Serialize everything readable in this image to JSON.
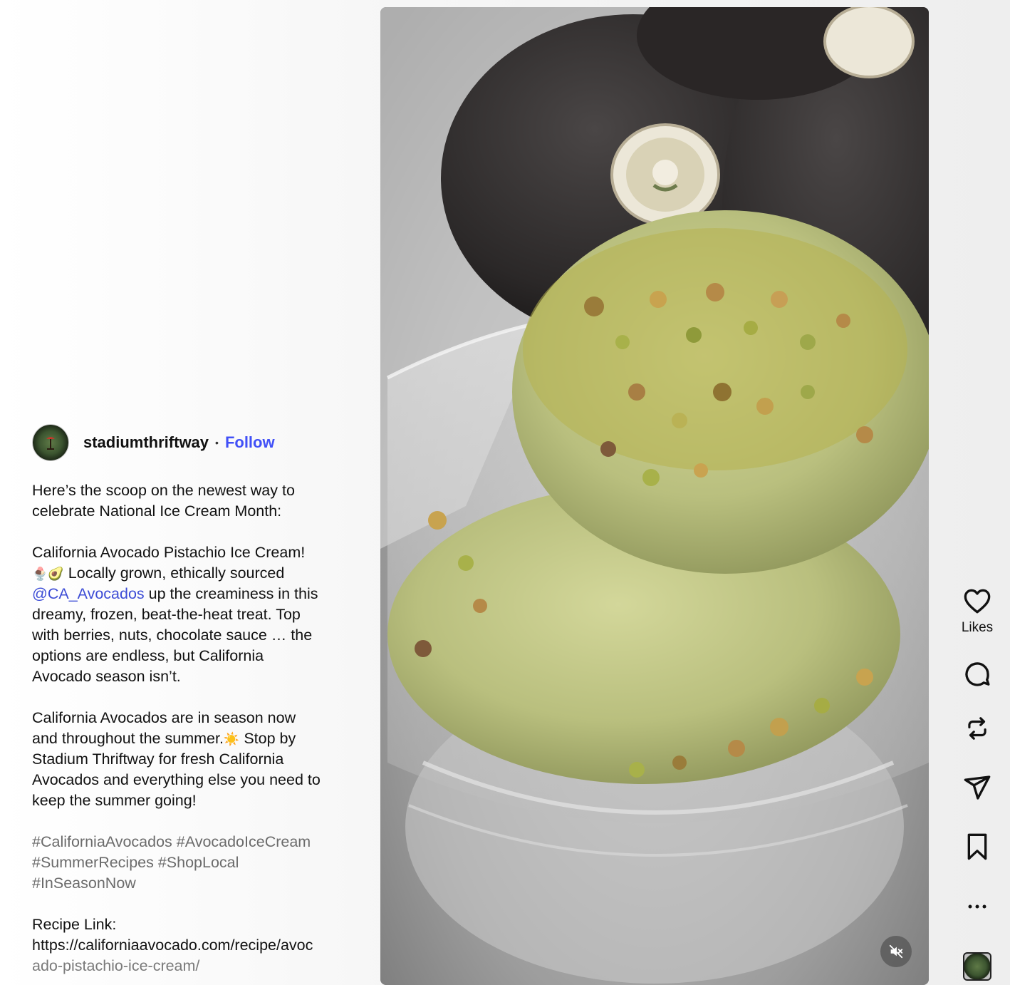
{
  "post": {
    "author": {
      "username": "stadiumthriftway",
      "separator": "•",
      "follow_label": "Follow"
    },
    "caption": {
      "intro_line1": "Here’s the scoop on the newest way to",
      "intro_line2": "celebrate National Ice Cream Month:",
      "p2_line1": "California Avocado Pistachio Ice Cream!",
      "p2_emoji": "🍨🥑",
      "p2_line2_text": " Locally grown, ethically sourced",
      "p2_mention": "@CA_Avocados",
      "p2_line3_text": " up the creaminess in this",
      "p2_line4": "dreamy, frozen, beat-the-heat treat. Top",
      "p2_line5": "with berries, nuts, chocolate sauce … the",
      "p2_line6": "options are endless, but California",
      "p2_line7": "Avocado season isn’t.",
      "p3_line1": "California Avocados are in season now",
      "p3_line2_text": "and throughout the summer.",
      "p3_emoji": "☀️",
      "p3_line2_rest": " Stop by",
      "p3_line3": "Stadium Thriftway for fresh California",
      "p3_line4": "Avocados and everything else you need to",
      "p3_line5": "keep the summer going!",
      "hashtags_line1": "#CaliforniaAvocados #AvocadoIceCream",
      "hashtags_line2": "#SummerRecipes #ShopLocal",
      "hashtags_line3": "#InSeasonNow",
      "recipe_label": "Recipe Link:",
      "recipe_url_line1": "https://californiaavocado.com/recipe/avoc",
      "recipe_url_line2": "ado-pistachio-ice-cream/"
    }
  },
  "actions": {
    "likes_label": "Likes",
    "icons": [
      "heart-icon",
      "comment-icon",
      "repost-icon",
      "share-icon",
      "bookmark-icon",
      "more-icon"
    ]
  },
  "media": {
    "muted": true,
    "mute_icon": "speaker-muted-icon"
  },
  "colors": {
    "follow": "#4150f7",
    "mention": "#3d4dd6",
    "hashtag": "#6b6b6b",
    "ice_cream": "#b8c07a",
    "avocado": "#2e2b2b"
  }
}
